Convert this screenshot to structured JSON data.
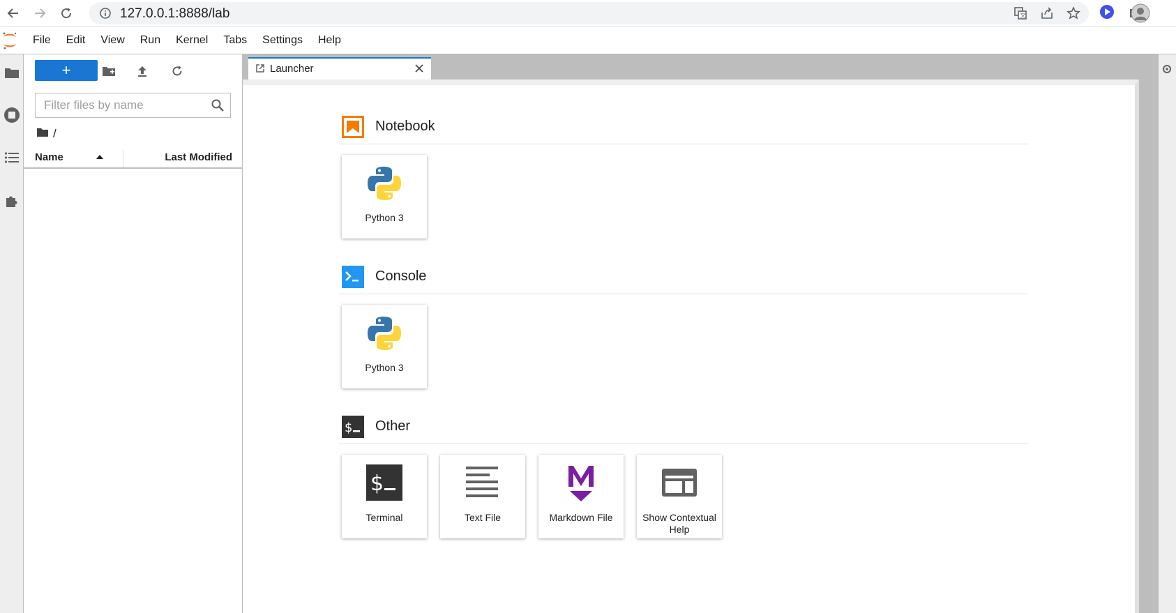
{
  "browser": {
    "url": "127.0.0.1:8888/lab",
    "nav_icons": [
      "back-arrow-icon",
      "forward-arrow-icon",
      "reload-icon"
    ],
    "address_actions": [
      "translate-icon",
      "share-icon",
      "bookmark-star-icon"
    ],
    "extension_icons": [
      "extension-play-icon",
      "extensions-puzzle-icon",
      "profile-avatar-icon"
    ]
  },
  "menubar": {
    "items": [
      "File",
      "Edit",
      "View",
      "Run",
      "Kernel",
      "Tabs",
      "Settings",
      "Help"
    ]
  },
  "filebrowser": {
    "new_launcher_label": "+",
    "filter_placeholder": "Filter files by name",
    "breadcrumb": "/",
    "columns": {
      "name": "Name",
      "last_modified": "Last Modified"
    }
  },
  "tab": {
    "label": "Launcher"
  },
  "launcher": {
    "sections": [
      {
        "title": "Notebook",
        "cards": [
          "Python 3"
        ]
      },
      {
        "title": "Console",
        "cards": [
          "Python 3"
        ]
      },
      {
        "title": "Other",
        "cards": [
          "Terminal",
          "Text File",
          "Markdown File",
          "Show Contextual Help"
        ]
      }
    ]
  },
  "colors": {
    "accent": "#1976d2",
    "notebook_orange": "#f57c00",
    "console_blue": "#2196f3",
    "markdown_purple": "#7b1fa2",
    "terminal_dark": "#333333"
  }
}
